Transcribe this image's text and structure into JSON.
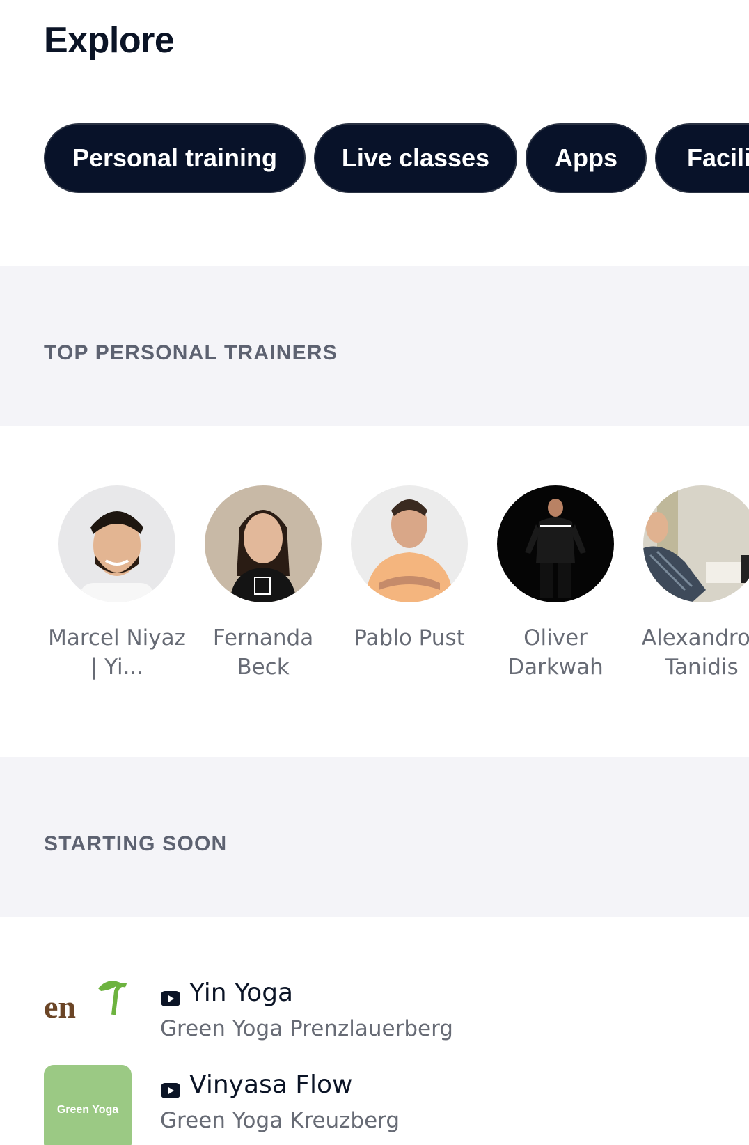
{
  "header": {
    "title": "Explore"
  },
  "chips": [
    {
      "label": "Personal training"
    },
    {
      "label": "Live classes"
    },
    {
      "label": "Apps"
    },
    {
      "label": "Facilit"
    }
  ],
  "trainers_section": {
    "title": "TOP PERSONAL TRAINERS",
    "trainers": [
      {
        "name": "Marcel Niyaz | Yi...",
        "icon": "avatar-photo"
      },
      {
        "name": "Fernanda Beck",
        "icon": "avatar-photo"
      },
      {
        "name": "Pablo Pust",
        "icon": "avatar-photo"
      },
      {
        "name": "Oliver Darkwah",
        "icon": "avatar-photo"
      },
      {
        "name": "Alexandros Tanidis",
        "icon": "avatar-photo"
      }
    ]
  },
  "starting_soon": {
    "title": "STARTING SOON",
    "classes": [
      {
        "title": "Yin Yoga",
        "studio": "Green Yoga Prenzlauerberg",
        "icon": "video-icon",
        "thumb_text": "en"
      },
      {
        "title": "Vinyasa Flow",
        "studio": "Green Yoga Kreuzberg",
        "icon": "video-icon",
        "thumb_text": "Green Yoga"
      }
    ]
  },
  "colors": {
    "chip_bg": "#081229",
    "title": "#0b1426",
    "section_bg": "#f4f4f8",
    "muted_text": "#676b75",
    "green_thumb": "#9bc984"
  }
}
